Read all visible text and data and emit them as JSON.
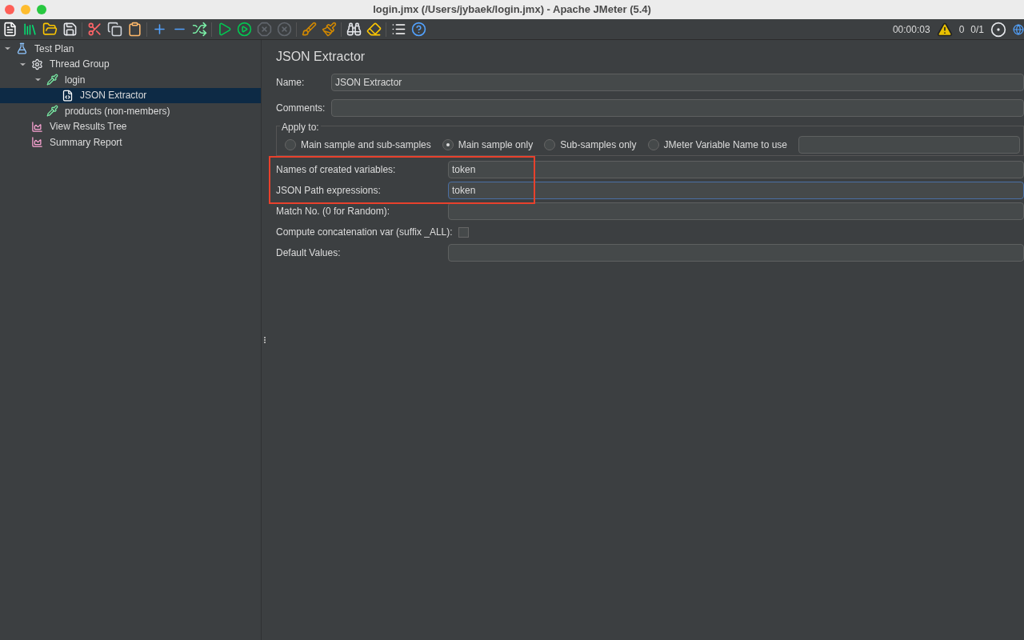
{
  "window": {
    "title": "login.jmx (/Users/jybaek/login.jmx) - Apache JMeter (5.4)"
  },
  "toolbar": {
    "buttons": [
      {
        "kind": "new",
        "disabled": false
      },
      {
        "kind": "templates",
        "disabled": false
      },
      {
        "kind": "open",
        "disabled": false
      },
      {
        "kind": "save",
        "disabled": false
      },
      {
        "kind": "sep"
      },
      {
        "kind": "cut",
        "disabled": false
      },
      {
        "kind": "copy",
        "disabled": false
      },
      {
        "kind": "paste",
        "disabled": false
      },
      {
        "kind": "sep"
      },
      {
        "kind": "expand",
        "disabled": false
      },
      {
        "kind": "collapse",
        "disabled": false
      },
      {
        "kind": "toggle",
        "disabled": false
      },
      {
        "kind": "sep"
      },
      {
        "kind": "start",
        "disabled": false
      },
      {
        "kind": "start-no-pause",
        "disabled": false
      },
      {
        "kind": "stop",
        "disabled": true
      },
      {
        "kind": "shutdown",
        "disabled": true
      },
      {
        "kind": "sep"
      },
      {
        "kind": "clear",
        "disabled": false
      },
      {
        "kind": "clear-all",
        "disabled": false
      },
      {
        "kind": "sep"
      },
      {
        "kind": "search",
        "disabled": false
      },
      {
        "kind": "reset-search",
        "disabled": false
      },
      {
        "kind": "sep"
      },
      {
        "kind": "function-helper",
        "disabled": false
      },
      {
        "kind": "help",
        "disabled": false
      }
    ],
    "elapsed": "00:00:03",
    "warnings": "0",
    "threads": "0/1"
  },
  "tree": [
    {
      "label": "Test Plan",
      "kind": "plan",
      "expanded": true,
      "selected": false,
      "children": [
        {
          "label": "Thread Group",
          "kind": "thread-group",
          "expanded": true,
          "selected": false,
          "children": [
            {
              "label": "login",
              "kind": "sampler",
              "expanded": true,
              "selected": false,
              "children": [
                {
                  "label": "JSON Extractor",
                  "kind": "extractor",
                  "selected": true
                }
              ]
            },
            {
              "label": "products (non-members)",
              "kind": "sampler",
              "selected": false
            }
          ]
        },
        {
          "label": "View Results Tree",
          "kind": "listener",
          "selected": false
        },
        {
          "label": "Summary Report",
          "kind": "listener",
          "selected": false
        }
      ]
    }
  ],
  "editor": {
    "title": "JSON Extractor",
    "name": {
      "label": "Name:",
      "value": "JSON Extractor"
    },
    "comments": {
      "label": "Comments:"
    },
    "apply_to": {
      "label": "Apply to:",
      "options": [
        {
          "label": "Main sample and sub-samples",
          "selected": false
        },
        {
          "label": "Main sample only",
          "selected": true
        },
        {
          "label": "Sub-samples only",
          "selected": false
        },
        {
          "label": "JMeter Variable Name to use",
          "selected": false
        }
      ]
    },
    "fields": [
      {
        "kind": "text",
        "label": "Names of created variables:",
        "value": "token",
        "focused": false,
        "highlighted": true
      },
      {
        "kind": "text",
        "label": "JSON Path expressions:",
        "value": "token",
        "focused": true,
        "highlighted": true
      },
      {
        "kind": "text",
        "label": "Match No. (0 for Random):",
        "focused": false,
        "highlighted": false
      },
      {
        "kind": "checkbox",
        "label": "Compute concatenation var (suffix _ALL):",
        "checked": false,
        "highlighted": false
      },
      {
        "kind": "text",
        "label": "Default Values:",
        "focused": false,
        "highlighted": false
      }
    ]
  }
}
